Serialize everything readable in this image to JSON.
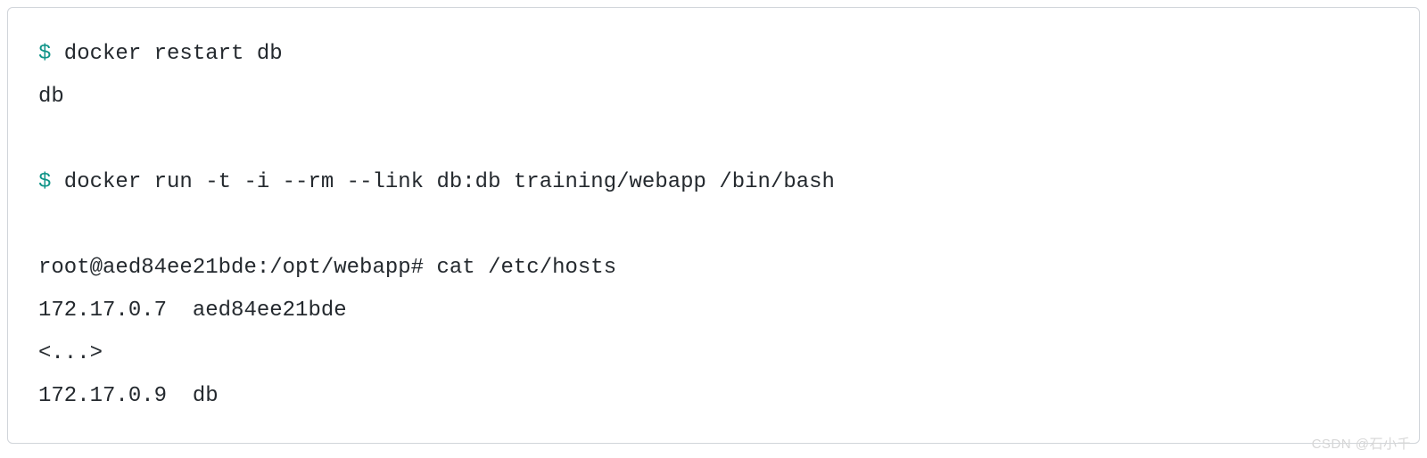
{
  "code": {
    "prompt_symbol": "$",
    "cmd1": " docker restart db",
    "out1": "db",
    "cmd2": " docker run -t -i --rm --link db:db training/webapp /bin/bash",
    "line3": "root@aed84ee21bde:/opt/webapp# cat /etc/hosts",
    "line4": "172.17.0.7  aed84ee21bde",
    "line5": "<...>",
    "line6": "172.17.0.9  db"
  },
  "watermark": "CSDN @石小千"
}
